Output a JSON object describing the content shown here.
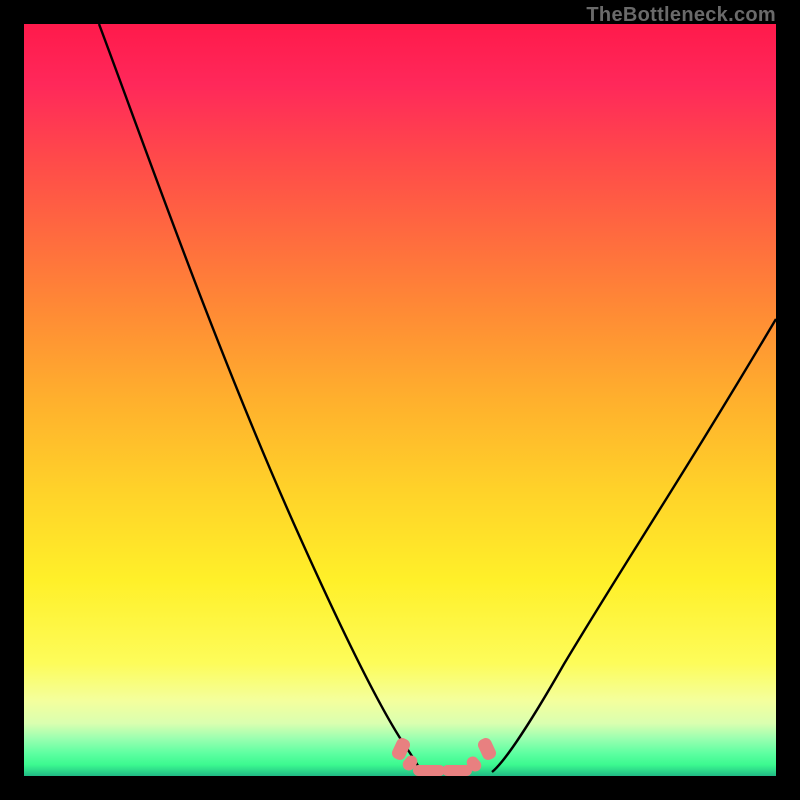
{
  "watermark": "TheBottleneck.com",
  "colors": {
    "curve": "#000000",
    "marker": "#e88080",
    "frame": "#000000"
  },
  "chart_data": {
    "type": "line",
    "title": "",
    "xlabel": "",
    "ylabel": "",
    "xlim": [
      0,
      100
    ],
    "ylim": [
      0,
      100
    ],
    "series": [
      {
        "name": "left-curve",
        "x": [
          10,
          15,
          20,
          25,
          30,
          35,
          40,
          45,
          48,
          50,
          52
        ],
        "y": [
          100,
          88,
          76,
          64,
          53,
          42,
          31,
          20,
          12,
          5,
          0
        ]
      },
      {
        "name": "right-curve",
        "x": [
          62,
          65,
          70,
          75,
          80,
          85,
          90,
          95,
          100
        ],
        "y": [
          0,
          5,
          14,
          23,
          32,
          40,
          48,
          55,
          62
        ]
      },
      {
        "name": "valley-markers",
        "x": [
          50,
          52,
          54,
          56,
          58,
          60,
          62
        ],
        "y": [
          3,
          1,
          0,
          0,
          0,
          1,
          3
        ]
      }
    ],
    "background_gradient": "red-to-green (vertical)",
    "grid": false,
    "legend": false
  }
}
